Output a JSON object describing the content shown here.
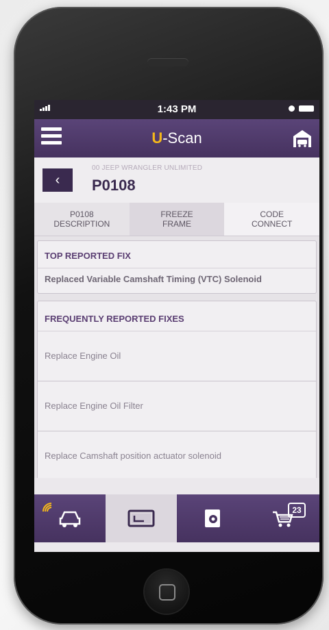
{
  "status": {
    "time": "1:43 PM"
  },
  "app": {
    "title_prefix": "U",
    "title_suffix": "-Scan"
  },
  "header": {
    "vehicle": "00 JEEP WRANGLER UNLIMITED",
    "code": "P0108"
  },
  "tabs": [
    {
      "line1": "P0108",
      "line2": "DESCRIPTION"
    },
    {
      "line1": "FREEZE",
      "line2": "FRAME"
    },
    {
      "line1": "CODE",
      "line2": "CONNECT"
    }
  ],
  "top_fix": {
    "title": "TOP REPORTED FIX",
    "text": "Replaced Variable Camshaft Timing (VTC) Solenoid"
  },
  "frequent": {
    "title": "FREQUENTLY REPORTED FIXES",
    "items": [
      "Replace Engine Oil",
      "Replace Engine Oil Filter",
      "Replace Camshaft position actuator solenoid"
    ]
  },
  "nav": {
    "cart_count": "23"
  },
  "colors": {
    "purple": "#46325f",
    "accent": "#f5b81a"
  },
  "icons": [
    "menu-icon",
    "garage-icon",
    "chevron-left-icon",
    "car-connect-icon",
    "scan-tool-icon",
    "report-icon",
    "cart-icon"
  ]
}
